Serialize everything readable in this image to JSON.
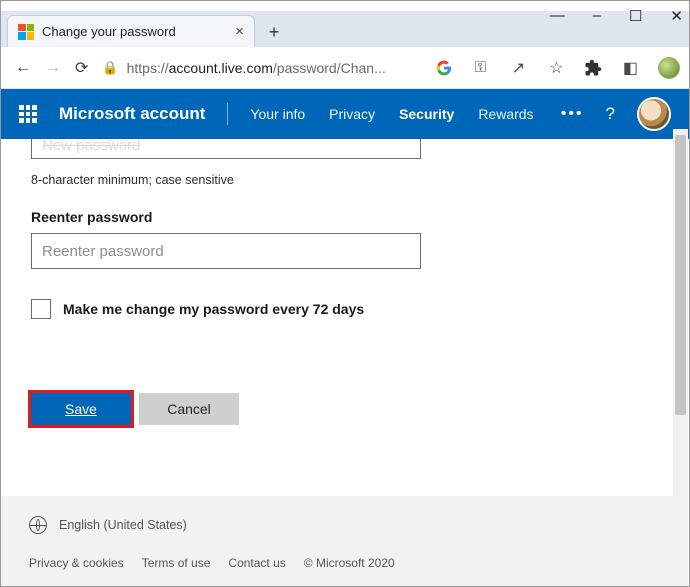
{
  "window": {
    "tab_title": "Change your password"
  },
  "address": {
    "scheme": "https://",
    "host": "account.live.com",
    "path": "/password/Chan..."
  },
  "bluebar": {
    "brand": "Microsoft account",
    "links": {
      "yourinfo": "Your info",
      "privacy": "Privacy",
      "security": "Security",
      "rewards": "Rewards"
    }
  },
  "form": {
    "ghost_input": "New password",
    "hint": "8-character minimum; case sensitive",
    "reenter_label": "Reenter password",
    "reenter_placeholder": "Reenter password",
    "checkbox_label": "Make me change my password every 72 days",
    "save": "Save",
    "cancel": "Cancel"
  },
  "footer": {
    "lang": "English (United States)",
    "privacy": "Privacy & cookies",
    "terms": "Terms of use",
    "contact": "Contact us",
    "copyright": "© Microsoft 2020"
  }
}
